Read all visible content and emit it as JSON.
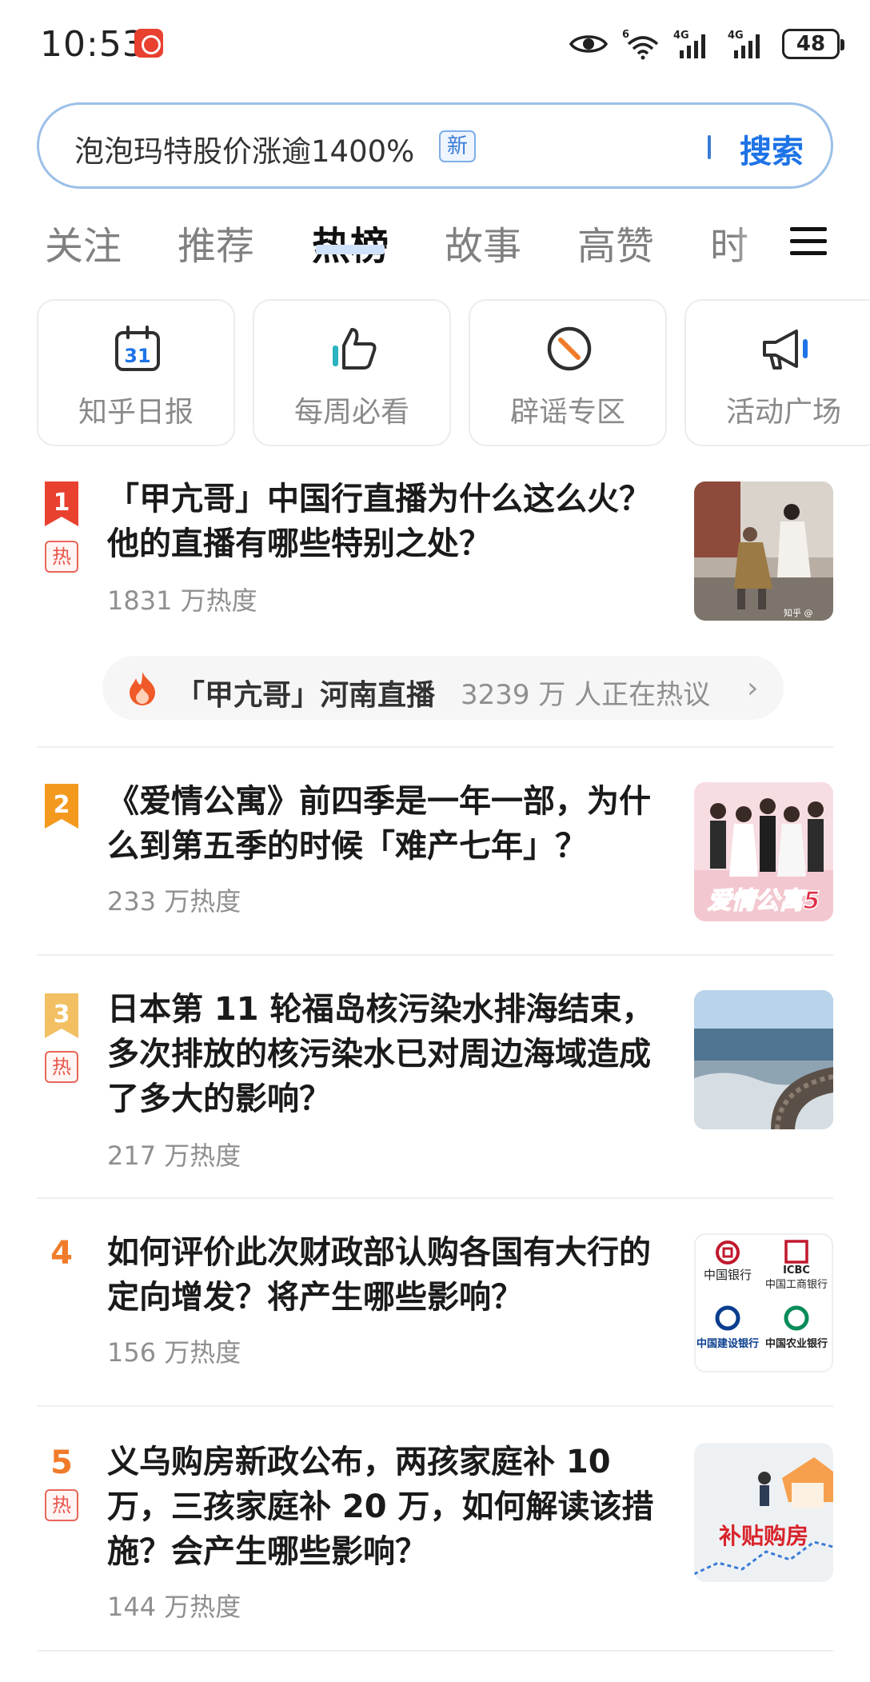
{
  "status_bar": {
    "time": "10:53",
    "network_1": "6",
    "network_2": "4G",
    "network_3": "4G",
    "battery": "48"
  },
  "search": {
    "query": "泡泡玛特股价涨逾1400%",
    "new_badge": "新",
    "button": "搜索"
  },
  "tabs": [
    {
      "label": "关注",
      "active": false
    },
    {
      "label": "推荐",
      "active": false
    },
    {
      "label": "热榜",
      "active": true
    },
    {
      "label": "故事",
      "active": false
    },
    {
      "label": "高赞",
      "active": false
    },
    {
      "label": "时",
      "active": false
    }
  ],
  "quick_links": [
    {
      "label": "知乎日报",
      "icon": "calendar-icon",
      "icon_text": "31"
    },
    {
      "label": "每周必看",
      "icon": "thumbs-up-icon"
    },
    {
      "label": "辟谣专区",
      "icon": "no-entry-icon"
    },
    {
      "label": "活动广场",
      "icon": "megaphone-icon"
    }
  ],
  "hot_list": [
    {
      "rank": "1",
      "hot_tag": "热",
      "title": "「甲亢哥」中国行直播为什么这么火？他的直播有哪些特别之处？",
      "heat": "1831 万热度",
      "live": {
        "topic": "「甲亢哥」河南直播",
        "count": "3239 万 人正在热议",
        "arrow": "›"
      },
      "thumb_caption": "知乎 @"
    },
    {
      "rank": "2",
      "title": "《爱情公寓》前四季是一年一部，为什么到第五季的时候「难产七年」？",
      "heat": "233 万热度",
      "thumb_caption": "爱情公寓5"
    },
    {
      "rank": "3",
      "hot_tag": "热",
      "title": "日本第 11 轮福岛核污染水排海结束，多次排放的核污染水已对周边海域造成了多大的影响？",
      "heat": "217 万热度"
    },
    {
      "rank": "4",
      "title": "如何评价此次财政部认购各国有大行的定向增发？将产生哪些影响？",
      "heat": "156 万热度",
      "thumb_banks": [
        "中国银行",
        "ICBC",
        "中国工商银行",
        "中国建设银行",
        "中国农业银行"
      ]
    },
    {
      "rank": "5",
      "hot_tag": "热",
      "title": "义乌购房新政公布，两孩家庭补 10 万，三孩家庭补 20 万，如何解读该措施？会产生哪些影响？",
      "heat": "144 万热度",
      "thumb_caption": "补贴购房"
    }
  ],
  "colors": {
    "accent_blue": "#1e73e6",
    "rank_1": "#e8412f",
    "rank_2": "#f39a1e",
    "rank_3": "#f2c063",
    "rank_other": "#f07b2a",
    "hot_tag": "#e8554a"
  }
}
